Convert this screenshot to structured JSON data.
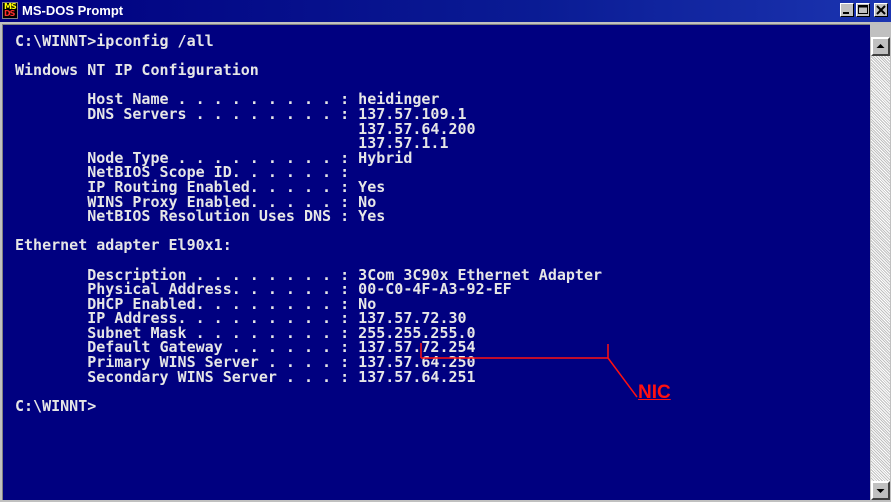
{
  "window": {
    "title": "MS-DOS Prompt",
    "icon": "ms-dos-icon",
    "controls": [
      "minimize-icon",
      "maximize-icon",
      "close-icon"
    ]
  },
  "console": {
    "lines": [
      "C:\\WINNT>ipconfig /all",
      "",
      "Windows NT IP Configuration",
      "",
      "        Host Name . . . . . . . . . : heidinger",
      "        DNS Servers . . . . . . . . : 137.57.109.1",
      "                                      137.57.64.200",
      "                                      137.57.1.1",
      "        Node Type . . . . . . . . . : Hybrid",
      "        NetBIOS Scope ID. . . . . . :",
      "        IP Routing Enabled. . . . . : Yes",
      "        WINS Proxy Enabled. . . . . : No",
      "        NetBIOS Resolution Uses DNS : Yes",
      "",
      "Ethernet adapter El90x1:",
      "",
      "        Description . . . . . . . . : 3Com 3C90x Ethernet Adapter",
      "        Physical Address. . . . . . : 00-C0-4F-A3-92-EF",
      "        DHCP Enabled. . . . . . . . : No",
      "        IP Address. . . . . . . . . : 137.57.72.30",
      "        Subnet Mask . . . . . . . . : 255.255.255.0",
      "        Default Gateway . . . . . . : 137.57.72.254",
      "        Primary WINS Server . . . . : 137.57.64.250",
      "        Secondary WINS Server . . . : 137.57.64.251",
      "",
      "C:\\WINNT>"
    ]
  },
  "annotation": {
    "label": "NIC",
    "color": "#ff1010"
  },
  "colors": {
    "console_bg": "#000080",
    "console_text": "#e6e6e6",
    "titlebar": "#000080"
  }
}
